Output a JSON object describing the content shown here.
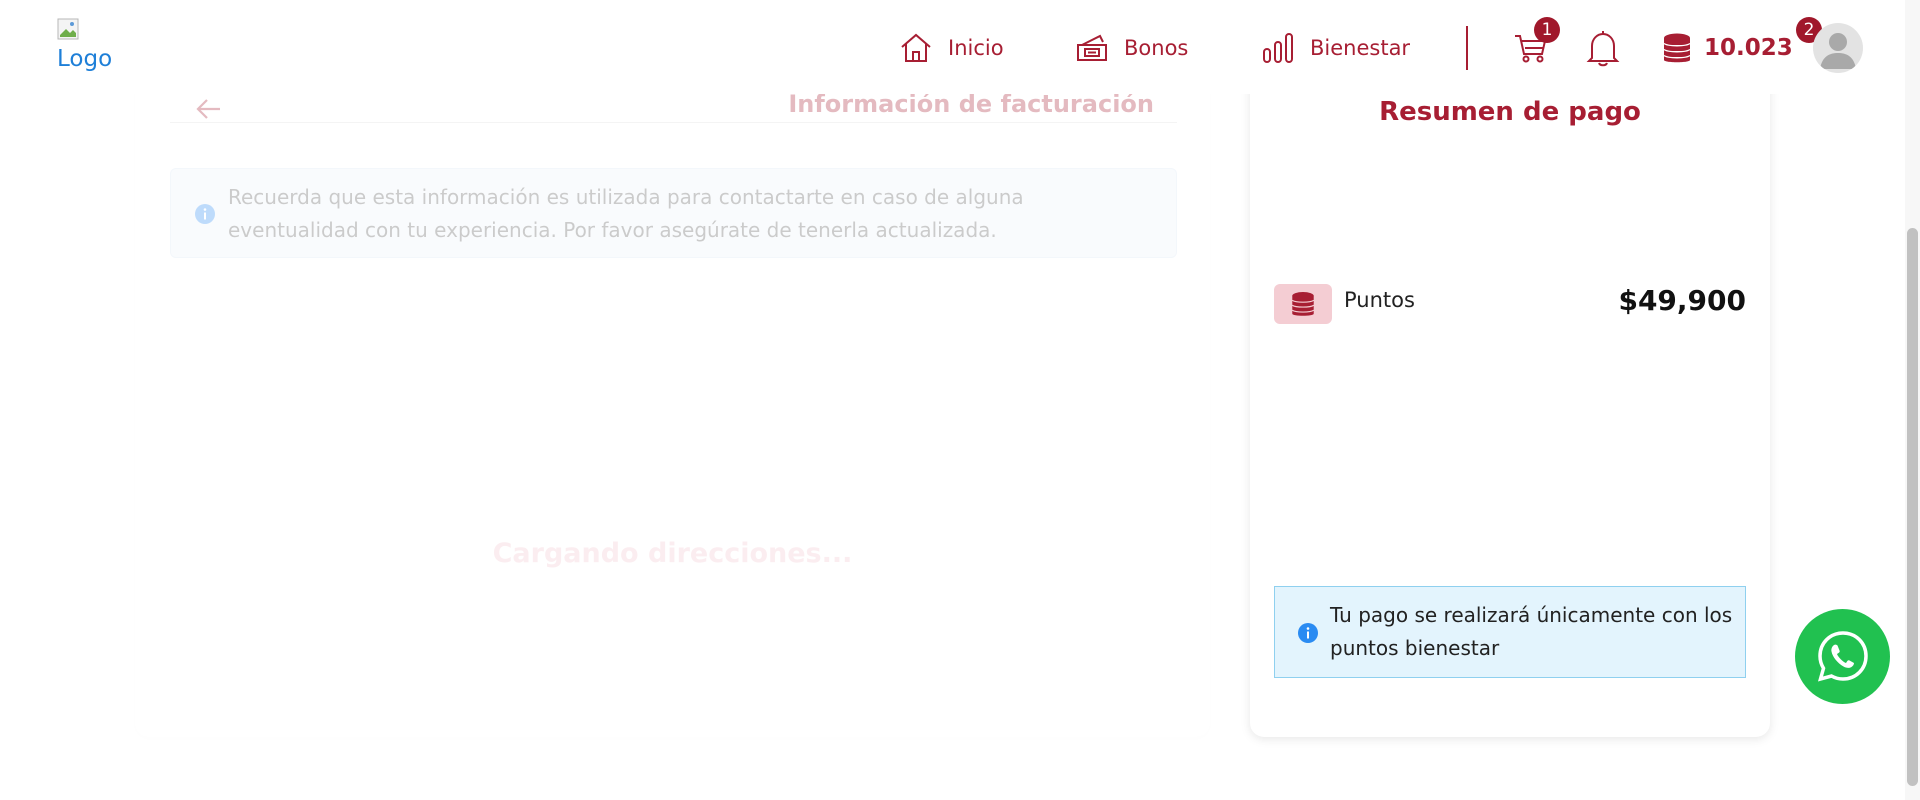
{
  "header": {
    "logo_alt": "Logo",
    "nav": [
      {
        "label": "Inicio",
        "icon": "home-icon"
      },
      {
        "label": "Bonos",
        "icon": "ticket-icon"
      },
      {
        "label": "Bienestar",
        "icon": "bar-chart-icon"
      }
    ],
    "cart_badge": "1",
    "points_value": "10.023",
    "profile_badge": "2"
  },
  "billing": {
    "title": "Información de facturación",
    "info_text": "Recuerda que esta información es utilizada para contactarte en caso de alguna eventualidad con tu experiencia. Por favor asegúrate de tenerla actualizada.",
    "loading_text": "Cargando direcciones..."
  },
  "summary": {
    "title": "Resumen de pago",
    "payment_method_label": "Puntos",
    "amount": "$49,900",
    "notice_text": "Tu pago se realizará únicamente con los puntos bienestar"
  },
  "colors": {
    "brand": "#a71e33",
    "badge": "#a0182b",
    "whatsapp": "#21c150",
    "info_blue": "#2a8bf2"
  }
}
